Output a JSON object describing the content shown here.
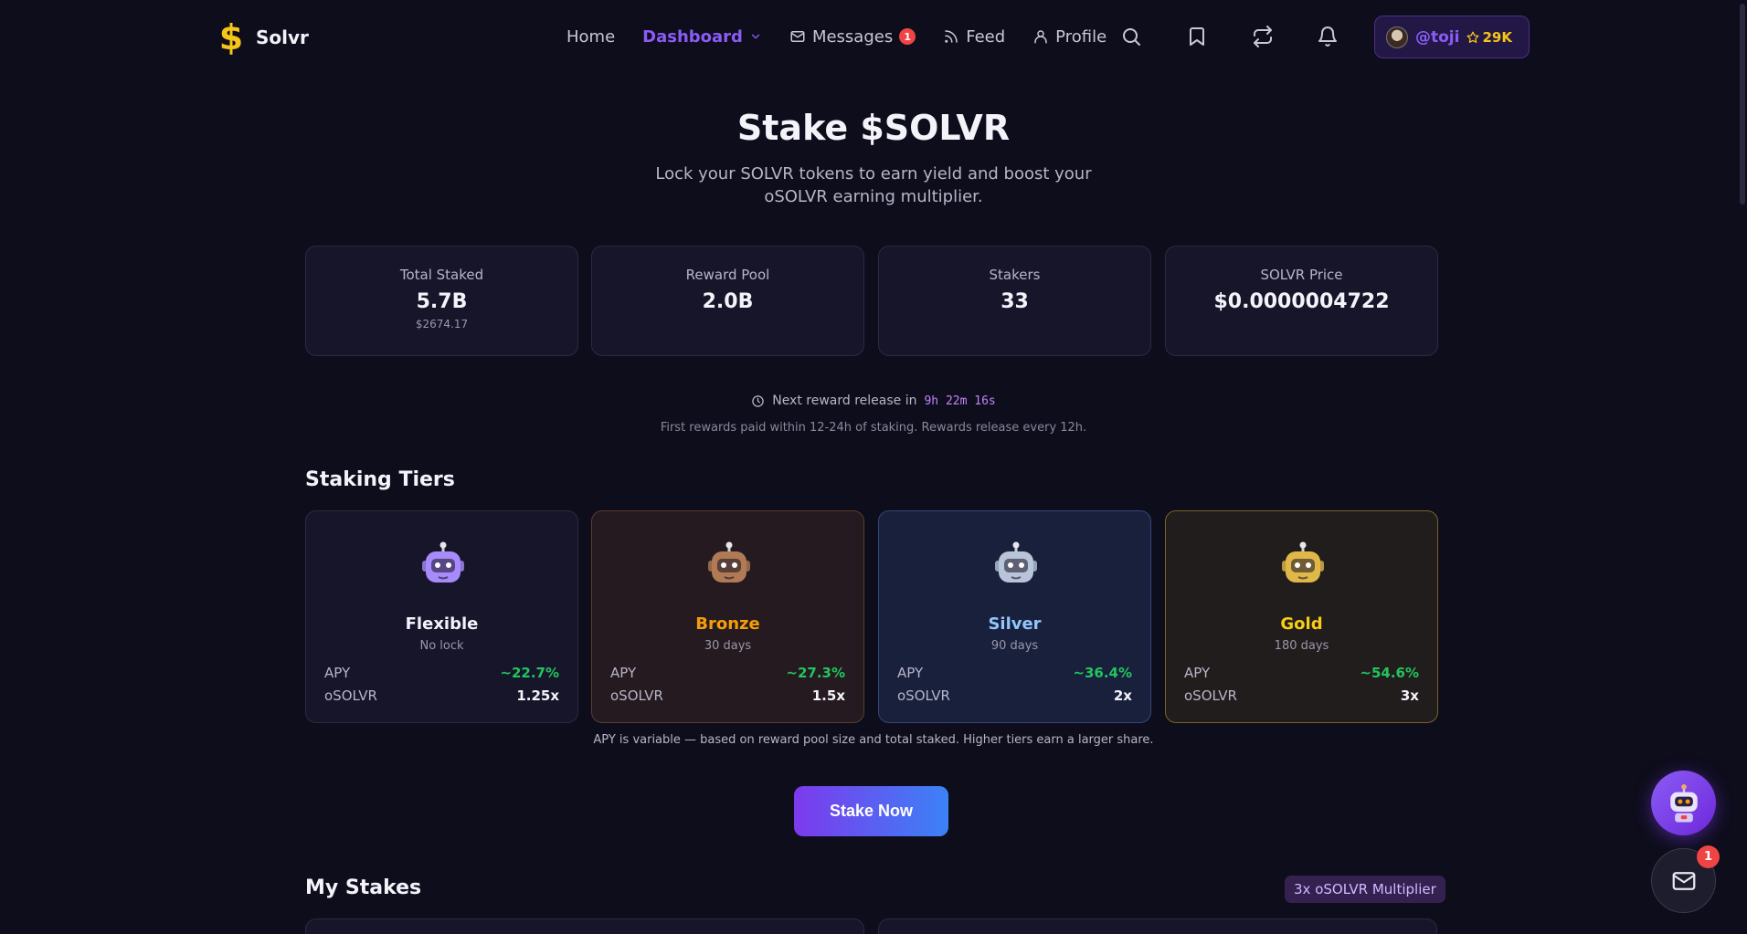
{
  "app": {
    "name": "Solvr",
    "logo_glyph": "$"
  },
  "nav": {
    "links": [
      {
        "label": "Home"
      },
      {
        "label": "Dashboard"
      },
      {
        "label": "Messages",
        "badge": "1"
      },
      {
        "label": "Feed"
      },
      {
        "label": "Profile"
      }
    ],
    "user": {
      "handle": "@toji",
      "points": "29K"
    }
  },
  "hero": {
    "title": "Stake $SOLVR",
    "subtitle": "Lock your SOLVR tokens to earn yield and boost your oSOLVR earning multiplier."
  },
  "stats": [
    {
      "label": "Total Staked",
      "value": "5.7B",
      "sub": "$2674.17"
    },
    {
      "label": "Reward Pool",
      "value": "2.0B"
    },
    {
      "label": "Stakers",
      "value": "33"
    },
    {
      "label": "SOLVR Price",
      "value": "$0.0000004722"
    }
  ],
  "reward": {
    "prefix": "Next reward release in",
    "countdown": "9h 22m 16s",
    "note": "First rewards paid within 12-24h of staking. Rewards release every 12h."
  },
  "tiers_section": {
    "title": "Staking Tiers"
  },
  "tiers": [
    {
      "name": "Flexible",
      "lock": "No lock",
      "apy_label": "APY",
      "apy": "~22.7%",
      "mult_label": "oSOLVR",
      "mult": "1.25x",
      "name_color": "#f4f3fa",
      "robot_color": "#a78bfa"
    },
    {
      "name": "Bronze",
      "lock": "30 days",
      "apy_label": "APY",
      "apy": "~27.3%",
      "mult_label": "oSOLVR",
      "mult": "1.5x",
      "name_color": "#f59e0b",
      "robot_color": "#b07a55"
    },
    {
      "name": "Silver",
      "lock": "90 days",
      "apy_label": "APY",
      "apy": "~36.4%",
      "mult_label": "oSOLVR",
      "mult": "2x",
      "name_color": "#93c5fd",
      "robot_color": "#b8c4d8"
    },
    {
      "name": "Gold",
      "lock": "180 days",
      "apy_label": "APY",
      "apy": "~54.6%",
      "mult_label": "oSOLVR",
      "mult": "3x",
      "name_color": "#facc15",
      "robot_color": "#e0b84a"
    }
  ],
  "apy_note": "APY is variable — based on reward pool size and total staked. Higher tiers earn a larger share.",
  "stake_button": "Stake Now",
  "my_stakes": {
    "title": "My Stakes",
    "multiplier_badge": "3x oSOLVR Multiplier"
  },
  "floating": {
    "mail_badge": "1"
  },
  "colors": {
    "accent": "#8b5cf6",
    "background": "#0e0d1c",
    "positive": "#22c55e",
    "points": "#f5c518"
  },
  "icons": [
    "dollar-logo-icon",
    "chevron-down-icon",
    "mail-icon",
    "rss-icon",
    "user-icon",
    "search-icon",
    "bookmark-icon",
    "repeat-icon",
    "bell-icon",
    "star-icon",
    "clock-icon",
    "robot-icon"
  ]
}
